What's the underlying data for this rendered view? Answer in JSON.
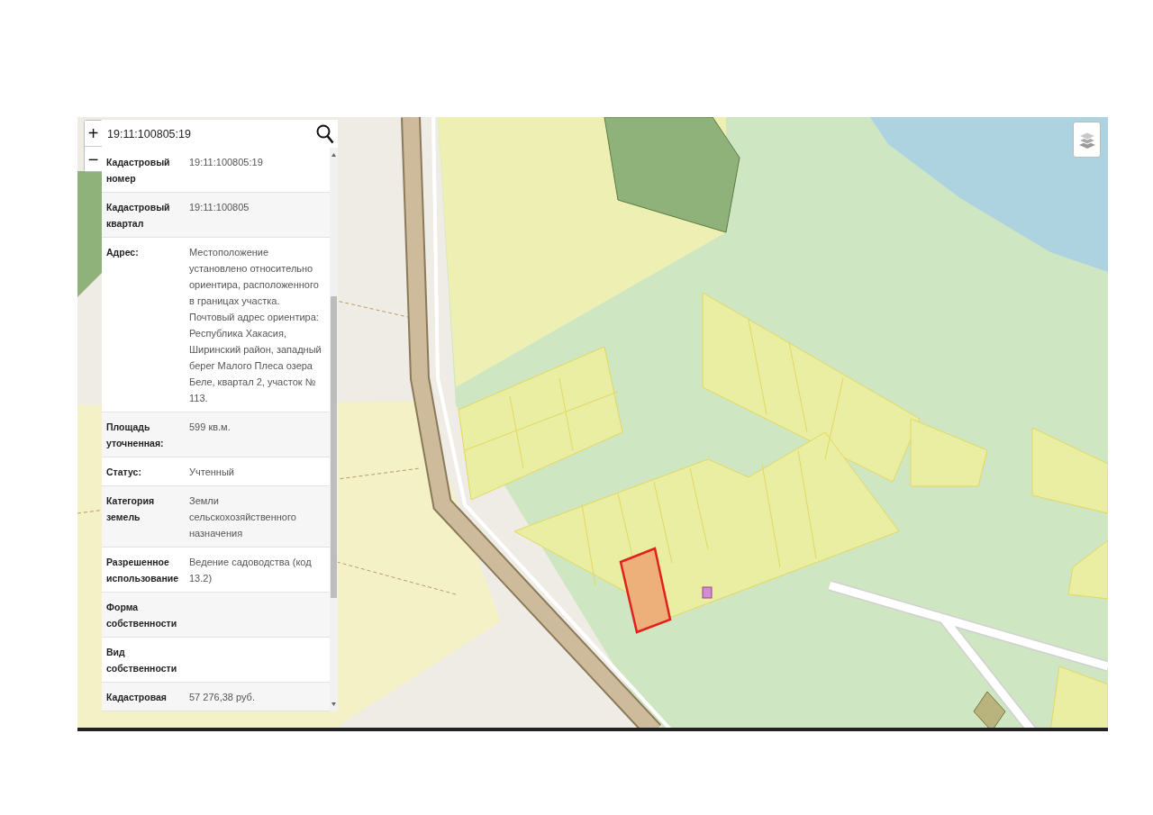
{
  "zoom": {
    "in_label": "+",
    "out_label": "−"
  },
  "search": {
    "value": "19:11:100805:19"
  },
  "attributes": [
    {
      "label": "Кадастровый номер",
      "value": "19:11:100805:19"
    },
    {
      "label": "Кадастровый квартал",
      "value": "19:11:100805"
    },
    {
      "label": "Адрес:",
      "value": "Местоположение установлено относительно ориентира, расположенного в границах участка. Почтовый адрес ориентира: Республика Хакасия, Ширинский район, западный берег Малого Плеса озера Беле, квартал 2, участок № 113."
    },
    {
      "label": "Площадь уточненная:",
      "value": "599 кв.м."
    },
    {
      "label": "Статус:",
      "value": "Учтенный"
    },
    {
      "label": "Категория земель",
      "value": "Земли сельскохозяйственного назначения"
    },
    {
      "label": "Разрешенное использование",
      "value": "Ведение садоводства (код 13.2)"
    },
    {
      "label": "Форма собственности"
    },
    {
      "label": "Вид собственности"
    },
    {
      "label": "Кадастровая",
      "value": "57 276,38 руб."
    }
  ]
}
